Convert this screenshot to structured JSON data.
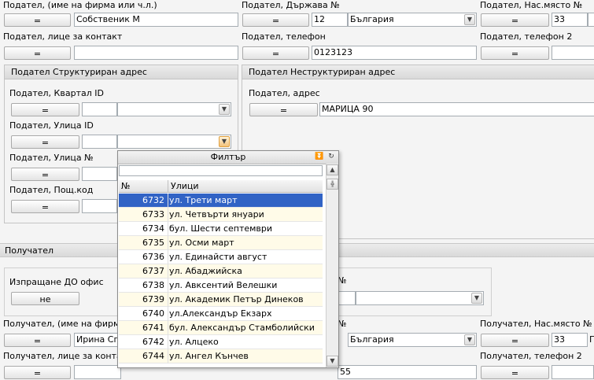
{
  "sender": {
    "name_label": "Подател, (име на фирма или ч.л.)",
    "name_value": "Собственик М",
    "country_label": "Подател, Държава №",
    "country_code": "12",
    "country_name": "България",
    "place_label": "Подател, Нас.място №",
    "place_code": "33",
    "contact_label": "Подател, лице за контакт",
    "contact_value": "",
    "phone_label": "Подател, телефон",
    "phone_value": "0123123",
    "phone2_label": "Подател, телефон 2",
    "structured_title": "Подател Структуриран адрес",
    "district_label": "Подател, Квартал ID",
    "street_label": "Подател, Улица ID",
    "street_no_label": "Подател, Улица №",
    "postcode_label": "Подател, Пощ.код",
    "unstructured_title": "Подател Неструктуриран адрес",
    "address_label": "Подател, адрес",
    "address_value": "МАРИЦА 90"
  },
  "eq_label": "=",
  "recipient": {
    "section_title": "Получател",
    "office_label": "Изпращане ДО офис",
    "office_button": "не",
    "name_label": "Получател, (име на фирма или ч.л.)",
    "name_value": "Ирина Спа",
    "country_name": "България",
    "place_label": "Получател, Нас.място №",
    "place_code": "33",
    "place_suffix": "П",
    "contact_label": "Получател, лице за контакт",
    "phone2_label": "Получател, телефон 2",
    "phone_value_partial": "55",
    "hidden_label_partial": "№"
  },
  "popup": {
    "title": "Филтър",
    "col_no": "№",
    "col_name": "Улици",
    "rows": [
      {
        "id": "6732",
        "name": "ул. Трети март"
      },
      {
        "id": "6733",
        "name": "ул. Четвърти януари"
      },
      {
        "id": "6734",
        "name": "бул. Шести септември"
      },
      {
        "id": "6735",
        "name": "ул. Осми март"
      },
      {
        "id": "6736",
        "name": "ул. Единайсти август"
      },
      {
        "id": "6737",
        "name": "ул. Абаджийска"
      },
      {
        "id": "6738",
        "name": "ул. Авксентий Велешки"
      },
      {
        "id": "6739",
        "name": "ул. Академик Петър Динеков"
      },
      {
        "id": "6740",
        "name": "ул.Александър Екзарх"
      },
      {
        "id": "6741",
        "name": "бул. Александър Стамболийски"
      },
      {
        "id": "6742",
        "name": "ул. Алцеко"
      },
      {
        "id": "6744",
        "name": "ул. Ангел Кънчев"
      }
    ],
    "selected_index": 0
  },
  "icons": {
    "dropdown": "chevron-down-icon",
    "collapse": "double-chevron-down-icon",
    "refresh": "refresh-icon",
    "scroll_up": "scroll-up-arrow-icon",
    "scroll_down": "scroll-down-arrow-icon",
    "columns": "columns-icon"
  },
  "colors": {
    "selection": "#3163c5",
    "row_alt": "#fffbe8",
    "combo_highlight": "#f0a030"
  }
}
